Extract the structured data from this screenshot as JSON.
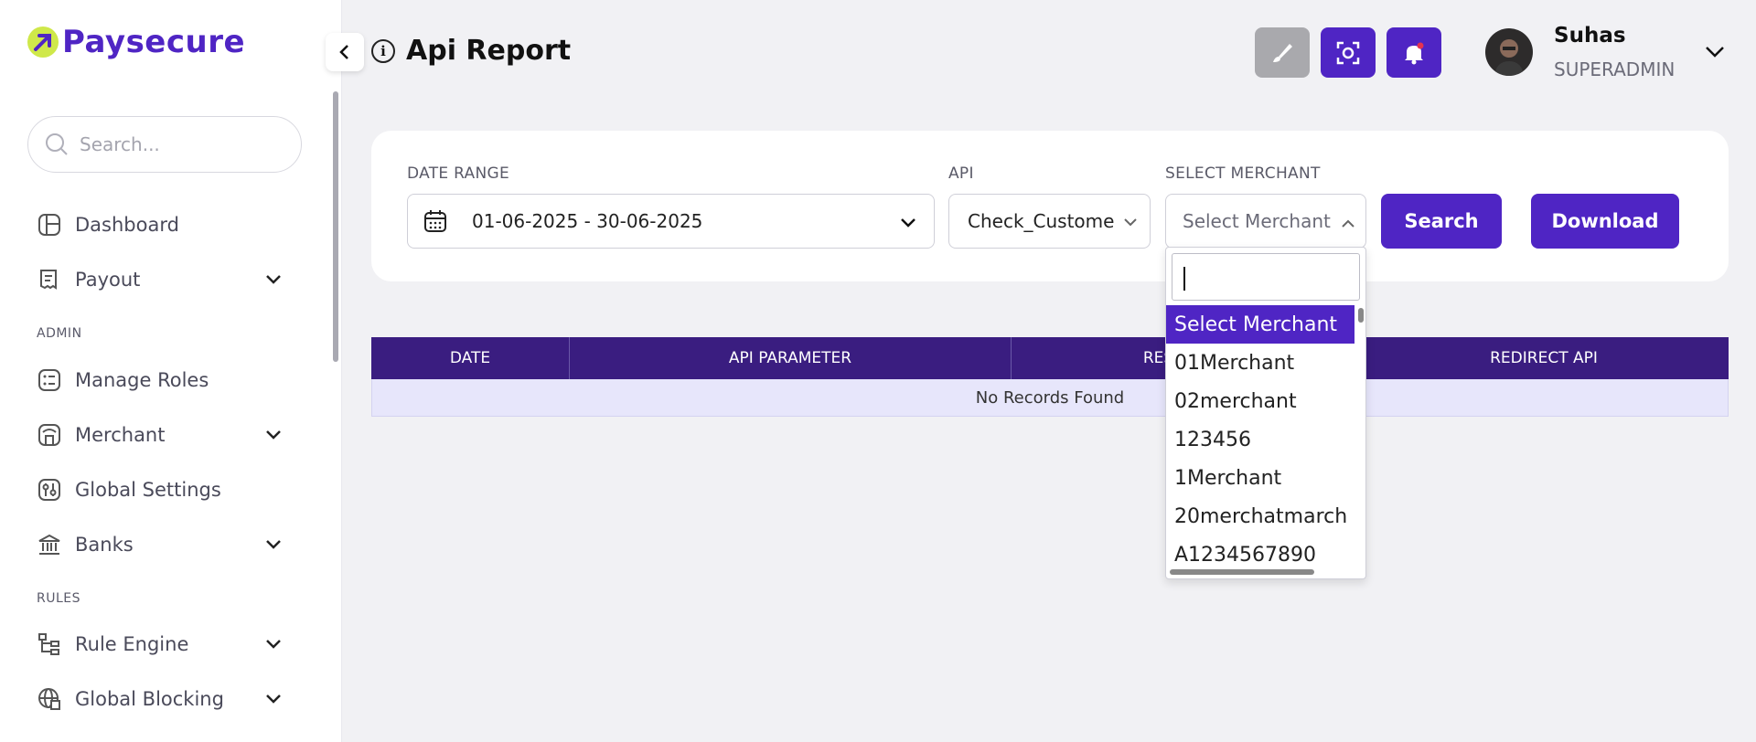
{
  "brand": {
    "name": "Paysecure",
    "color": "#4f25c4",
    "accent": "#cfe84a"
  },
  "sidebar": {
    "search_placeholder": "Search...",
    "items": [
      {
        "label": "Dashboard",
        "icon": "dashboard-icon"
      },
      {
        "label": "Payout",
        "icon": "receipt-icon",
        "expandable": true
      },
      {
        "label": "Manage Roles",
        "icon": "list-icon"
      },
      {
        "label": "Merchant",
        "icon": "store-icon",
        "expandable": true
      },
      {
        "label": "Global Settings",
        "icon": "sliders-icon"
      },
      {
        "label": "Banks",
        "icon": "bank-icon",
        "expandable": true
      },
      {
        "label": "Rule Engine",
        "icon": "tree-icon",
        "expandable": true
      },
      {
        "label": "Global Blocking",
        "icon": "globe-grid-icon",
        "expandable": true
      }
    ],
    "sections": {
      "admin": "ADMIN",
      "rules": "RULES"
    }
  },
  "header": {
    "title": "Api Report",
    "user": {
      "name": "Suhas",
      "role": "SUPERADMIN"
    }
  },
  "filters": {
    "date_range": {
      "label": "DATE RANGE",
      "value": "01-06-2025 - 30-06-2025"
    },
    "api": {
      "label": "API",
      "value": "Check_Customer"
    },
    "merchant": {
      "label": "SELECT MERCHANT",
      "value": "Select Merchant"
    },
    "search_label": "Search",
    "download_label": "Download"
  },
  "table": {
    "columns": [
      "DATE",
      "API PARAMETER",
      "RESPONSE",
      "REDIRECT API"
    ],
    "empty_text": "No Records Found"
  },
  "merchant_dropdown": {
    "search_value": "",
    "options": [
      "Select Merchant",
      "01Merchant",
      "02merchant",
      "123456",
      "1Merchant",
      "20merchatmarch",
      "A1234567890"
    ],
    "selected_index": 0
  }
}
